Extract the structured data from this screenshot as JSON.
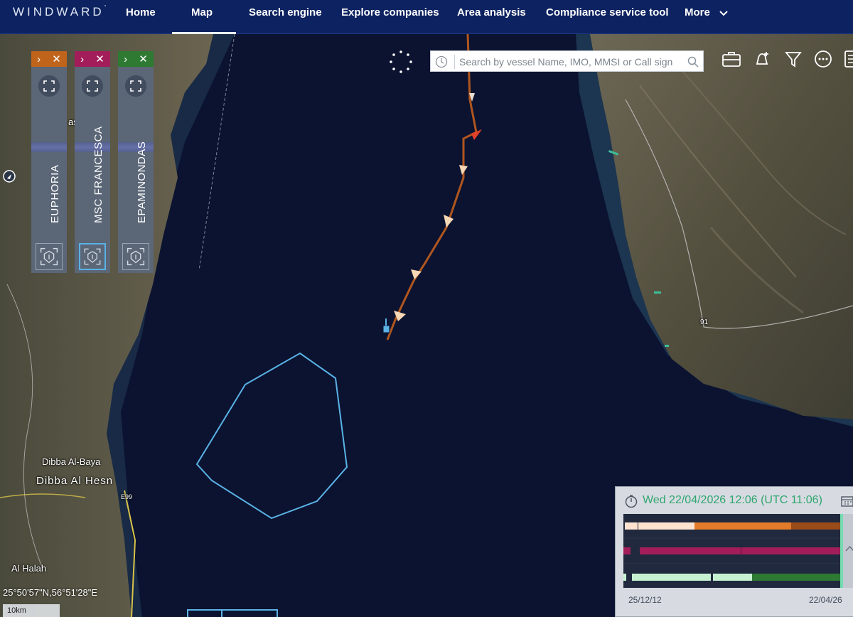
{
  "brand": "WINDWARD",
  "brand_mark": "°",
  "nav": [
    {
      "label": "Home",
      "active": false
    },
    {
      "label": "Map",
      "active": true
    },
    {
      "label": "Search engine",
      "active": false
    },
    {
      "label": "Explore companies",
      "active": false
    },
    {
      "label": "Area analysis",
      "active": false
    },
    {
      "label": "Compliance service tool",
      "active": false
    },
    {
      "label": "More",
      "active": false
    }
  ],
  "search": {
    "placeholder": "Search by vessel Name, IMO, MMSI or Call sign"
  },
  "toolbar_icons": [
    "briefcase-icon",
    "alert-add-icon",
    "filter-icon",
    "more-options-icon",
    "list-icon"
  ],
  "vessels": [
    {
      "name": "EUPHORIA",
      "color": "#c0641c"
    },
    {
      "name": "MSC FRANCESCA",
      "color": "#a31d5a"
    },
    {
      "name": "EPAMINONDAS",
      "color": "#2e7a33"
    }
  ],
  "map_labels": {
    "dibba_baya": "Dibba Al-Baya",
    "dibba_hesn": "Dibba Al Hesn",
    "al_halah": "Al Halah",
    "road_91": "91",
    "road_e99": "E99",
    "partial_as": "as"
  },
  "coordinates": "25°50'57\"N,56°51'28\"E",
  "scale": "10km",
  "timeline": {
    "current": "Wed 22/04/2026 12:06 (UTC 11:06)",
    "start": "25/12/12",
    "end": "22/04/26"
  },
  "colors": {
    "nav_bg": "#0d2260",
    "sea": "#0b1330",
    "track": "#b0561e",
    "area_outline": "#5ab2e6",
    "timeline_date": "#2fa66f"
  }
}
